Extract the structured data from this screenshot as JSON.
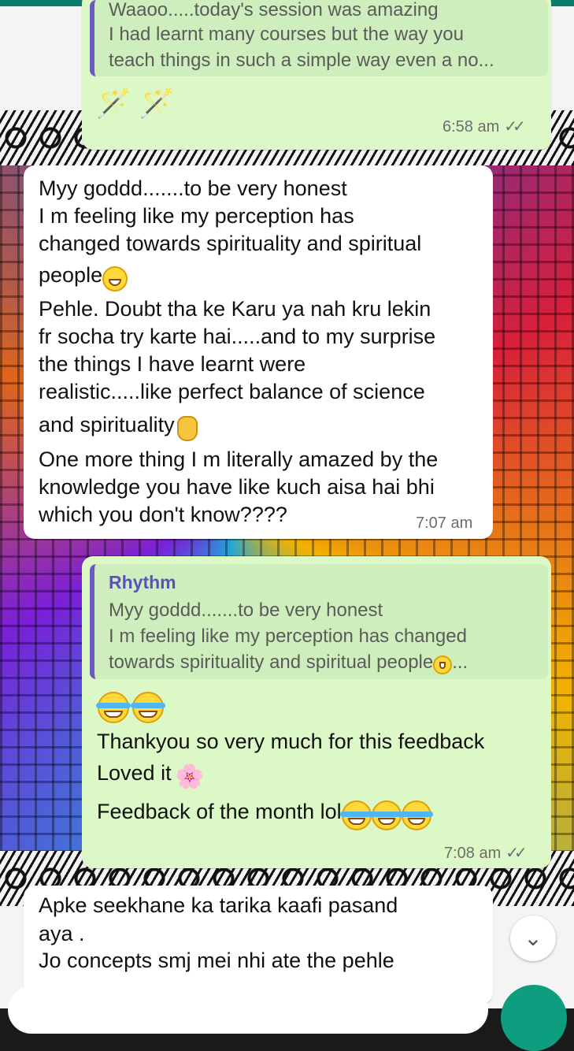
{
  "messages": [
    {
      "quote_line1": "Waaoo.....today's session was amazing",
      "quote_line2": "I had learnt many courses but the way you",
      "quote_line3": "teach things in such a simple way even a no...",
      "wands": "🪄 🪄",
      "time": "6:58 am",
      "ticks": "✓✓"
    },
    {
      "lines": [
        "Myy goddd.......to be very honest",
        "I m feeling like my perception has",
        "changed towards spirituality and spiritual",
        "people",
        "Pehle. Doubt tha ke Karu ya nah kru lekin",
        "fr socha try karte hai.....and to my surprise",
        "the things I have learnt were",
        "realistic.....like perfect balance of science",
        "and spirituality",
        "One more thing I m literally amazed by the",
        "knowledge you have like kuch aisa hai bhi",
        "which you don't know????"
      ],
      "time": "7:07 am"
    },
    {
      "quote_name": "Rhythm",
      "quote_line1": "Myy goddd.......to be very honest",
      "quote_line2": "I m feeling like my perception has changed",
      "quote_line3": "towards spirituality and spiritual people",
      "quote_ellipsis": "...",
      "lines": [
        "Thankyou so very much for this feedback",
        "Loved it",
        "Feedback of the month lol"
      ],
      "flower": "🌸",
      "time": "7:08 am",
      "ticks": "✓✓"
    },
    {
      "lines": [
        "Apke seekhane ka tarika kaafi pasand",
        "aya .",
        "Jo concepts smj mei nhi ate the pehle"
      ]
    }
  ],
  "controls": {
    "scroll_down_icon": "double-chevron-down-icon",
    "scroll_down_glyph": "⌄"
  },
  "colors": {
    "outgoing_bubble": "#dcf8c6",
    "incoming_bubble": "#ffffff",
    "quote_author": "#5b52b8",
    "fab": "#0f9d7f"
  }
}
